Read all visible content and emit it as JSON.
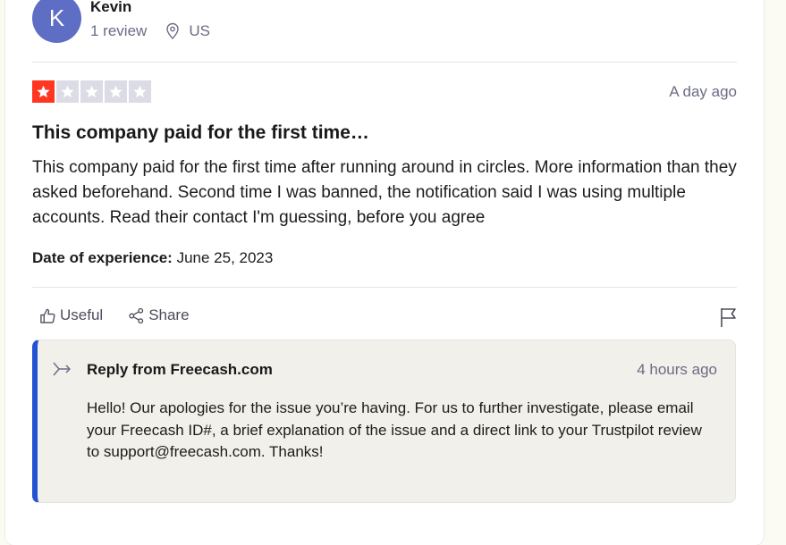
{
  "reviewer": {
    "avatar_letter": "K",
    "name": "Kevin",
    "review_count": "1 review",
    "location_icon": "location-pin-icon",
    "country": "US",
    "avatar_color": "#5d6ec4"
  },
  "review": {
    "rating": 1,
    "rating_max": 5,
    "star_color": "#ff3722",
    "relative_date": "A day ago",
    "title": "This company paid for the first time…",
    "body": "This company paid for the first time after running around in circles. More information than they asked beforehand. Second time I was banned, the notification said I was using multiple accounts. Read their contact I'm guessing, before you agree",
    "experience_label": "Date of experience:",
    "experience_date": " June 25, 2023"
  },
  "actions": {
    "useful_icon": "thumbs-up-icon",
    "useful_label": "Useful",
    "share_icon": "share-icon",
    "share_label": "Share",
    "flag_icon": "flag-icon"
  },
  "reply": {
    "icon": "reply-arrow-icon",
    "title": "Reply from Freecash.com",
    "date": "4 hours ago",
    "body": "Hello! Our apologies for the issue you’re having. For us to further investigate, please email your Freecash ID#, a brief explanation of the issue and a direct link to your Trustpilot review to support@freecash.com. Thanks!",
    "accent_color": "#2352d3"
  }
}
